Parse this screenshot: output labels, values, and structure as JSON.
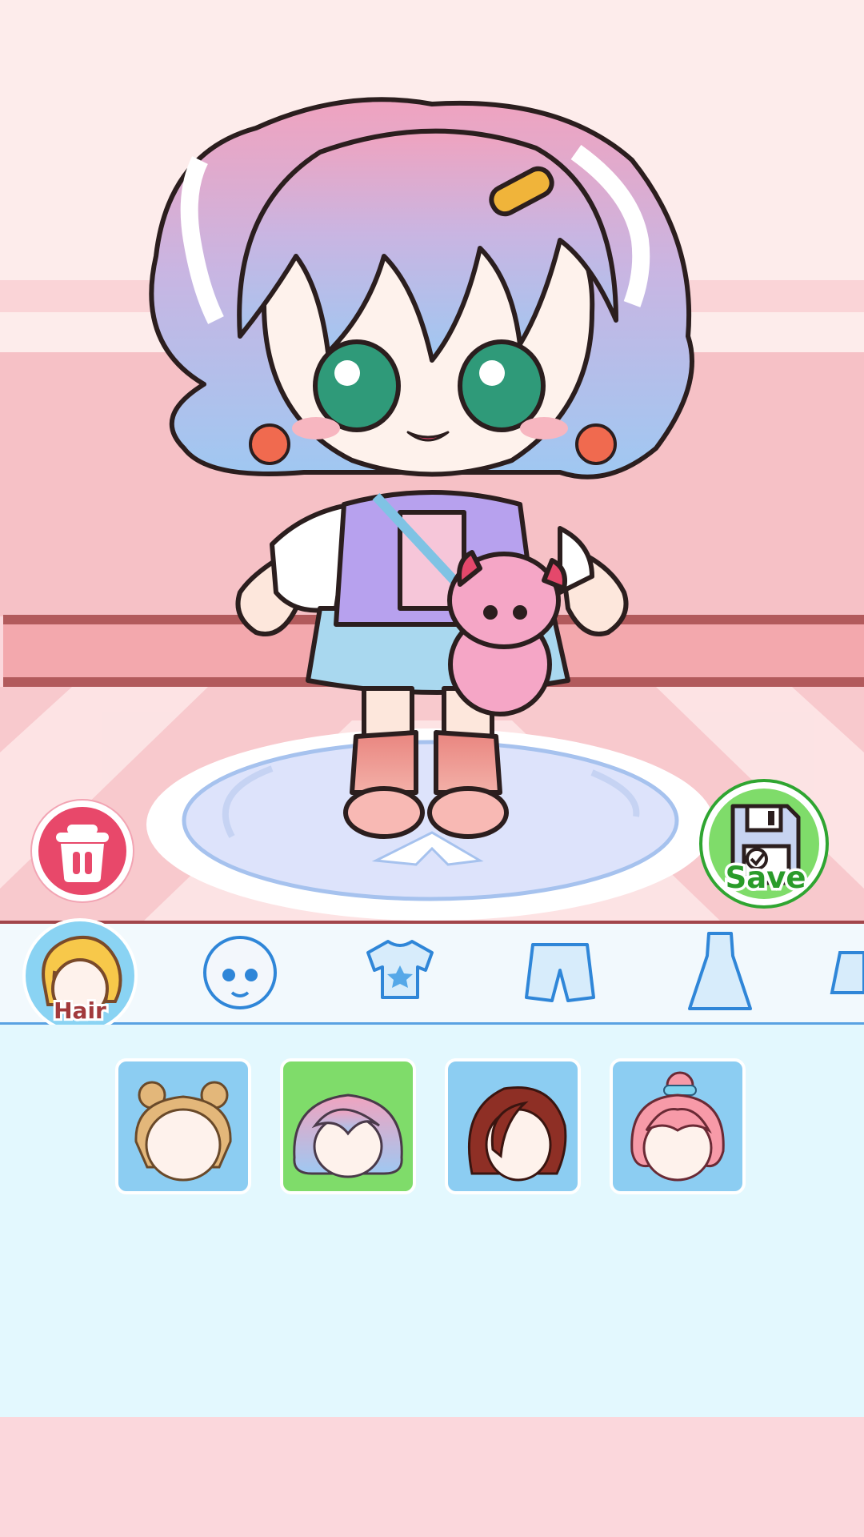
{
  "actions": {
    "delete_icon": "trash-icon",
    "save_label": "Save",
    "save_icon": "floppy-disk-icon"
  },
  "categories": {
    "selected": "Hair",
    "tabs": [
      {
        "label": "Hair",
        "icon": "hair-icon",
        "selected": true
      },
      {
        "label": "",
        "icon": "face-icon",
        "selected": false
      },
      {
        "label": "",
        "icon": "shirt-icon",
        "selected": false
      },
      {
        "label": "",
        "icon": "shorts-icon",
        "selected": false
      },
      {
        "label": "",
        "icon": "dress-icon",
        "selected": false
      },
      {
        "label": "",
        "icon": "socks-icon",
        "selected": false
      }
    ]
  },
  "hair_options": [
    {
      "name": "blonde-space-buns",
      "selected": false
    },
    {
      "name": "pastel-twin-braids",
      "selected": true
    },
    {
      "name": "brown-bob",
      "selected": false
    },
    {
      "name": "pink-bun-with-bow",
      "selected": false
    }
  ],
  "colors": {
    "accent_selected": "#7fdc6a",
    "item_bg": "#8ccdf2",
    "delete": "#e8486a",
    "save": "#2fa531"
  }
}
